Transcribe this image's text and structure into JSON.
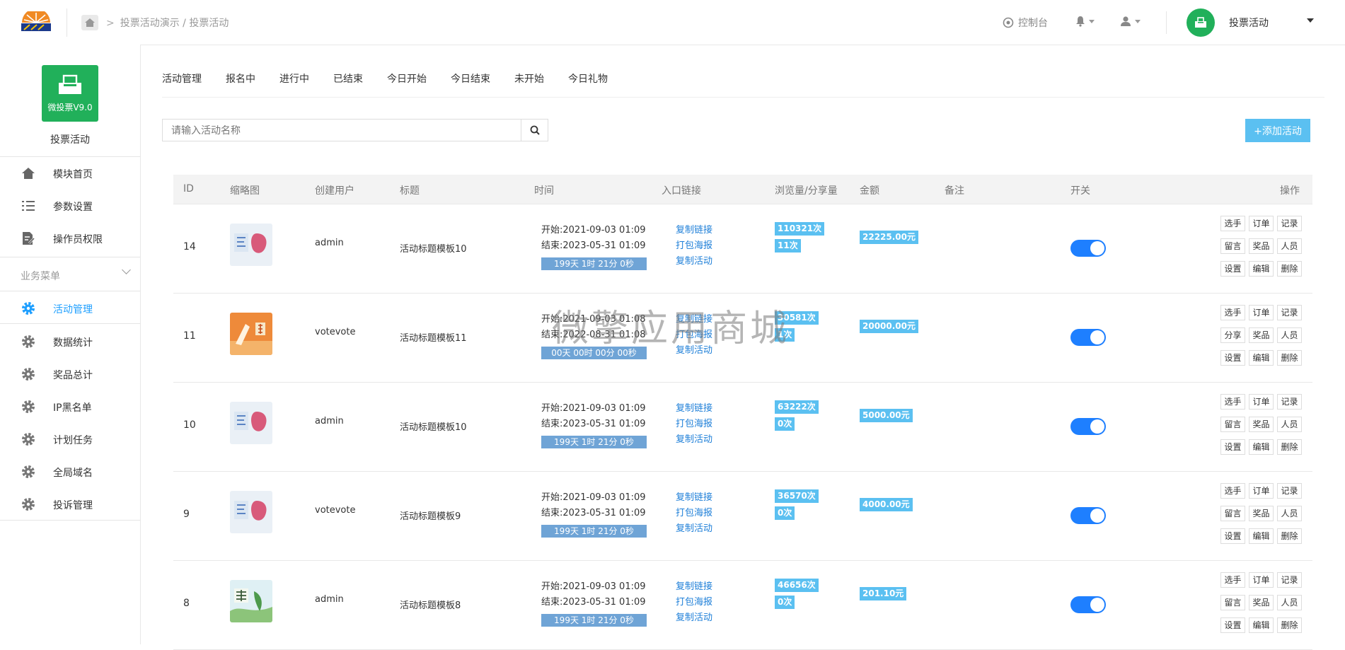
{
  "header": {
    "breadcrumb": "投票活动演示 / 投票活动",
    "console_label": "控制台",
    "user_name": "投票活动"
  },
  "sidebar": {
    "app_tile_label": "微投票V9.0",
    "app_title": "投票活动",
    "top_items": [
      "模块首页",
      "参数设置",
      "操作员权限"
    ],
    "group_label": "业务菜单",
    "biz_items": [
      "活动管理",
      "数据统计",
      "奖品总计",
      "IP黑名单",
      "计划任务",
      "全局域名",
      "投诉管理"
    ]
  },
  "tabs": [
    "活动管理",
    "报名中",
    "进行中",
    "已结束",
    "今日开始",
    "今日结束",
    "未开始",
    "今日礼物"
  ],
  "search": {
    "placeholder": "请输入活动名称"
  },
  "add_button": "+添加活动",
  "table": {
    "headers": [
      "ID",
      "缩略图",
      "创建用户",
      "标题",
      "时间",
      "入口链接",
      "浏览量/分享量",
      "金额",
      "备注",
      "开关",
      "操作"
    ],
    "link_labels": [
      "复制链接",
      "打包海报",
      "复制活动"
    ],
    "rows": [
      {
        "id": "14",
        "user": "admin",
        "title": "活动标题模板10",
        "start": "开始:2021-09-03 01:09",
        "end": "结束:2023-05-31 01:09",
        "countdown": "199天 1时 21分 0秒",
        "views": "110321次",
        "shares": "11次",
        "amount": "22225.00元",
        "actions": [
          "选手",
          "订单",
          "记录",
          "留言",
          "奖品",
          "人员",
          "设置",
          "编辑",
          "删除"
        ]
      },
      {
        "id": "11",
        "user": "votevote",
        "title": "活动标题模板11",
        "start": "开始:2021-09-03 01:08",
        "end": "结束:2022-08-31 01:08",
        "countdown": "00天 00时 00分 00秒",
        "views": "30581次",
        "shares": "1次",
        "amount": "20000.00元",
        "actions": [
          "选手",
          "订单",
          "记录",
          "分享",
          "奖品",
          "人员",
          "设置",
          "编辑",
          "删除"
        ]
      },
      {
        "id": "10",
        "user": "admin",
        "title": "活动标题模板10",
        "start": "开始:2021-09-03 01:09",
        "end": "结束:2023-05-31 01:09",
        "countdown": "199天 1时 21分 0秒",
        "views": "63222次",
        "shares": "0次",
        "amount": "5000.00元",
        "actions": [
          "选手",
          "订单",
          "记录",
          "留言",
          "奖品",
          "人员",
          "设置",
          "编辑",
          "删除"
        ]
      },
      {
        "id": "9",
        "user": "votevote",
        "title": "活动标题模板9",
        "start": "开始:2021-09-03 01:09",
        "end": "结束:2023-05-31 01:09",
        "countdown": "199天 1时 21分 0秒",
        "views": "36570次",
        "shares": "0次",
        "amount": "4000.00元",
        "actions": [
          "选手",
          "订单",
          "记录",
          "留言",
          "奖品",
          "人员",
          "设置",
          "编辑",
          "删除"
        ]
      },
      {
        "id": "8",
        "user": "admin",
        "title": "活动标题模板8",
        "start": "开始:2021-09-03 01:09",
        "end": "结束:2023-05-31 01:09",
        "countdown": "199天 1时 21分 0秒",
        "views": "46656次",
        "shares": "0次",
        "amount": "201.10元",
        "actions": [
          "选手",
          "订单",
          "记录",
          "留言",
          "奖品",
          "人员",
          "设置",
          "编辑",
          "删除"
        ]
      }
    ]
  },
  "watermark": "微擎应用商城",
  "colors": {
    "brand_green": "#21b05a",
    "accent_blue": "#1e9fff",
    "badge_blue": "#5bc0f1",
    "countdown_blue": "#6fa4d6"
  }
}
